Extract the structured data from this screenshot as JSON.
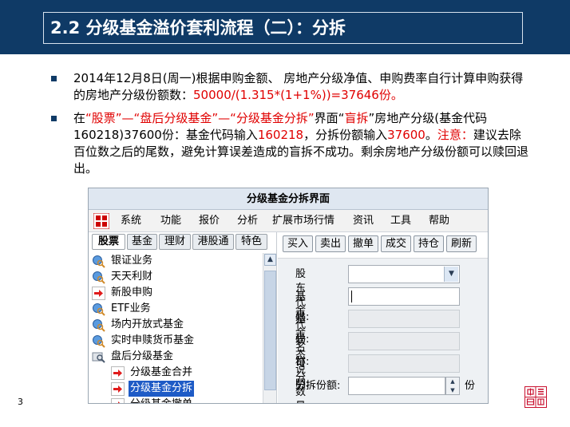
{
  "slide": {
    "title": "2.2 分级基金溢价套利流程（二）：分拆",
    "page_number": "3",
    "logo_text": "中信證券",
    "colors": {
      "title_bg": "#0f3a66",
      "highlight": "#e00000"
    }
  },
  "bullets": [
    {
      "parts": [
        {
          "text": "2014年12月8日(周一)根据申购金额、 房地产分级净值、申购费率自行计算申购获得的房地产分级份额数：",
          "red": false
        },
        {
          "text": "50000/(1.315*(1+1%))=37646份。",
          "red": true
        }
      ]
    },
    {
      "parts": [
        {
          "text": "在",
          "red": false
        },
        {
          "text": "“股票”—“盘后分级基金”—“分级基金分拆”",
          "red": true
        },
        {
          "text": "界面“",
          "red": false
        },
        {
          "text": "盲拆",
          "red": true
        },
        {
          "text": "”房地产分级(基金代码160218)37600份：基金代码输入",
          "red": false
        },
        {
          "text": "160218",
          "red": true
        },
        {
          "text": "，分拆份额输入",
          "red": false
        },
        {
          "text": "37600",
          "red": true
        },
        {
          "text": "。",
          "red": false
        },
        {
          "text": "注意：",
          "red": true
        },
        {
          "text": "建议去除百位数之后的尾数，避免计算误差造成的盲拆不成功。剩余房地产分级份额可以赎回退出。",
          "red": false
        }
      ]
    }
  ],
  "app": {
    "window_title": "分级基金分拆界面",
    "menu": [
      "系统",
      "功能",
      "报价",
      "分析",
      "扩展市场行情",
      "资讯",
      "工具",
      "帮助"
    ],
    "tabs": [
      "股票",
      "基金",
      "理财",
      "港股通",
      "特色"
    ],
    "active_tab": "股票",
    "tree": [
      {
        "label": "银证业务",
        "icon": "globe-search-icon"
      },
      {
        "label": "天天利财",
        "icon": "globe-search-icon"
      },
      {
        "label": "新股申购",
        "icon": "red-arrow-icon"
      },
      {
        "label": "ETF业务",
        "icon": "globe-search-icon"
      },
      {
        "label": "场内开放式基金",
        "icon": "globe-search-icon"
      },
      {
        "label": "实时申赎货币基金",
        "icon": "globe-search-icon"
      },
      {
        "label": "盘后分级基金",
        "icon": "folder-search-icon"
      },
      {
        "label": "分级基金合并",
        "icon": "red-arrow-icon"
      },
      {
        "label": "分级基金分拆",
        "icon": "red-arrow-icon"
      },
      {
        "label": "分级基金撤单",
        "icon": "red-arrow-icon"
      }
    ],
    "selected_item": "分级基金分拆",
    "actions": [
      "买入",
      "卖出",
      "撤单",
      "成交",
      "持仓",
      "刷新"
    ],
    "form": {
      "shareholder_code_label": "股东代码:",
      "shareholder_code_value": "",
      "fund_code_label": "基金代码:",
      "fund_code_value": "",
      "fund_name_label": "基金名称:",
      "fund_name_value": "",
      "status_label": "状态说明:",
      "status_value": "",
      "available_label": "可分数量:",
      "available_value": "",
      "split_label": "分拆份额:",
      "split_value": "",
      "unit": "份"
    }
  }
}
